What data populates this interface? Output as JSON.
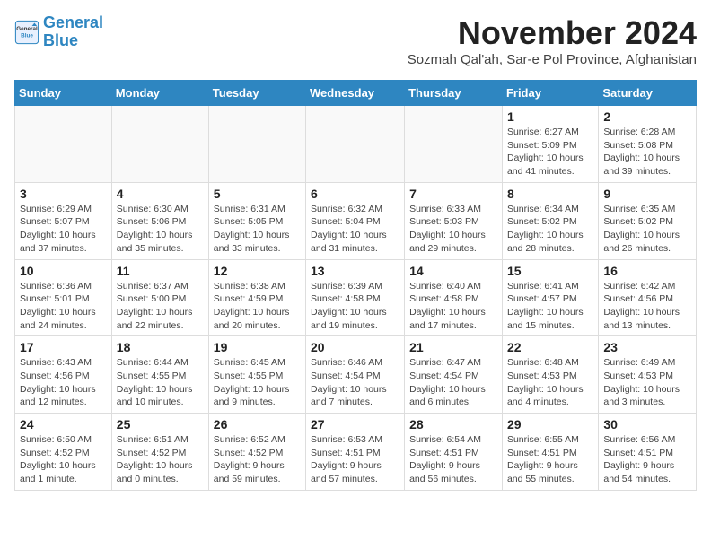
{
  "logo": {
    "line1": "General",
    "line2": "Blue"
  },
  "title": "November 2024",
  "location": "Sozmah Qal'ah, Sar-e Pol Province, Afghanistan",
  "weekdays": [
    "Sunday",
    "Monday",
    "Tuesday",
    "Wednesday",
    "Thursday",
    "Friday",
    "Saturday"
  ],
  "weeks": [
    [
      {
        "day": "",
        "info": ""
      },
      {
        "day": "",
        "info": ""
      },
      {
        "day": "",
        "info": ""
      },
      {
        "day": "",
        "info": ""
      },
      {
        "day": "",
        "info": ""
      },
      {
        "day": "1",
        "info": "Sunrise: 6:27 AM\nSunset: 5:09 PM\nDaylight: 10 hours\nand 41 minutes."
      },
      {
        "day": "2",
        "info": "Sunrise: 6:28 AM\nSunset: 5:08 PM\nDaylight: 10 hours\nand 39 minutes."
      }
    ],
    [
      {
        "day": "3",
        "info": "Sunrise: 6:29 AM\nSunset: 5:07 PM\nDaylight: 10 hours\nand 37 minutes."
      },
      {
        "day": "4",
        "info": "Sunrise: 6:30 AM\nSunset: 5:06 PM\nDaylight: 10 hours\nand 35 minutes."
      },
      {
        "day": "5",
        "info": "Sunrise: 6:31 AM\nSunset: 5:05 PM\nDaylight: 10 hours\nand 33 minutes."
      },
      {
        "day": "6",
        "info": "Sunrise: 6:32 AM\nSunset: 5:04 PM\nDaylight: 10 hours\nand 31 minutes."
      },
      {
        "day": "7",
        "info": "Sunrise: 6:33 AM\nSunset: 5:03 PM\nDaylight: 10 hours\nand 29 minutes."
      },
      {
        "day": "8",
        "info": "Sunrise: 6:34 AM\nSunset: 5:02 PM\nDaylight: 10 hours\nand 28 minutes."
      },
      {
        "day": "9",
        "info": "Sunrise: 6:35 AM\nSunset: 5:02 PM\nDaylight: 10 hours\nand 26 minutes."
      }
    ],
    [
      {
        "day": "10",
        "info": "Sunrise: 6:36 AM\nSunset: 5:01 PM\nDaylight: 10 hours\nand 24 minutes."
      },
      {
        "day": "11",
        "info": "Sunrise: 6:37 AM\nSunset: 5:00 PM\nDaylight: 10 hours\nand 22 minutes."
      },
      {
        "day": "12",
        "info": "Sunrise: 6:38 AM\nSunset: 4:59 PM\nDaylight: 10 hours\nand 20 minutes."
      },
      {
        "day": "13",
        "info": "Sunrise: 6:39 AM\nSunset: 4:58 PM\nDaylight: 10 hours\nand 19 minutes."
      },
      {
        "day": "14",
        "info": "Sunrise: 6:40 AM\nSunset: 4:58 PM\nDaylight: 10 hours\nand 17 minutes."
      },
      {
        "day": "15",
        "info": "Sunrise: 6:41 AM\nSunset: 4:57 PM\nDaylight: 10 hours\nand 15 minutes."
      },
      {
        "day": "16",
        "info": "Sunrise: 6:42 AM\nSunset: 4:56 PM\nDaylight: 10 hours\nand 13 minutes."
      }
    ],
    [
      {
        "day": "17",
        "info": "Sunrise: 6:43 AM\nSunset: 4:56 PM\nDaylight: 10 hours\nand 12 minutes."
      },
      {
        "day": "18",
        "info": "Sunrise: 6:44 AM\nSunset: 4:55 PM\nDaylight: 10 hours\nand 10 minutes."
      },
      {
        "day": "19",
        "info": "Sunrise: 6:45 AM\nSunset: 4:55 PM\nDaylight: 10 hours\nand 9 minutes."
      },
      {
        "day": "20",
        "info": "Sunrise: 6:46 AM\nSunset: 4:54 PM\nDaylight: 10 hours\nand 7 minutes."
      },
      {
        "day": "21",
        "info": "Sunrise: 6:47 AM\nSunset: 4:54 PM\nDaylight: 10 hours\nand 6 minutes."
      },
      {
        "day": "22",
        "info": "Sunrise: 6:48 AM\nSunset: 4:53 PM\nDaylight: 10 hours\nand 4 minutes."
      },
      {
        "day": "23",
        "info": "Sunrise: 6:49 AM\nSunset: 4:53 PM\nDaylight: 10 hours\nand 3 minutes."
      }
    ],
    [
      {
        "day": "24",
        "info": "Sunrise: 6:50 AM\nSunset: 4:52 PM\nDaylight: 10 hours\nand 1 minute."
      },
      {
        "day": "25",
        "info": "Sunrise: 6:51 AM\nSunset: 4:52 PM\nDaylight: 10 hours\nand 0 minutes."
      },
      {
        "day": "26",
        "info": "Sunrise: 6:52 AM\nSunset: 4:52 PM\nDaylight: 9 hours\nand 59 minutes."
      },
      {
        "day": "27",
        "info": "Sunrise: 6:53 AM\nSunset: 4:51 PM\nDaylight: 9 hours\nand 57 minutes."
      },
      {
        "day": "28",
        "info": "Sunrise: 6:54 AM\nSunset: 4:51 PM\nDaylight: 9 hours\nand 56 minutes."
      },
      {
        "day": "29",
        "info": "Sunrise: 6:55 AM\nSunset: 4:51 PM\nDaylight: 9 hours\nand 55 minutes."
      },
      {
        "day": "30",
        "info": "Sunrise: 6:56 AM\nSunset: 4:51 PM\nDaylight: 9 hours\nand 54 minutes."
      }
    ]
  ]
}
